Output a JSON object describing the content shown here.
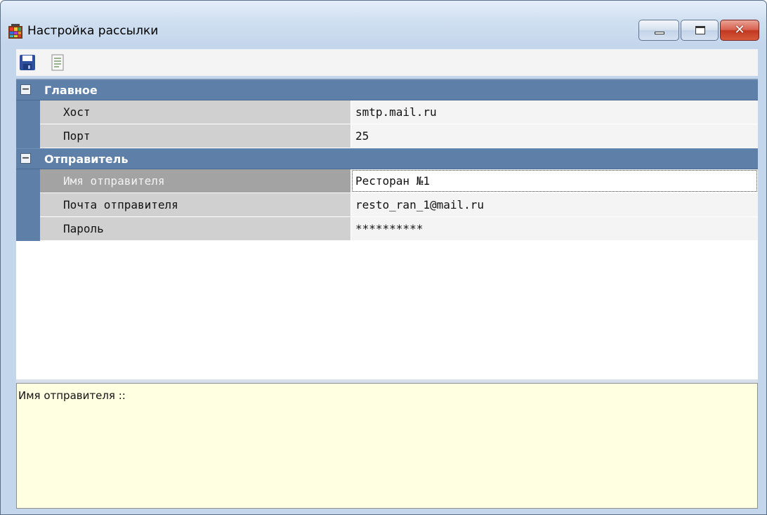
{
  "window": {
    "title": "Настройка рассылки",
    "colors": {
      "category_header": "#5d7fa8",
      "description_bg": "#ffffe1",
      "close_button": "#c1371f"
    }
  },
  "window_controls": {
    "minimize_icon": "minimize-icon",
    "maximize_icon": "maximize-icon",
    "close_label": "✕"
  },
  "toolbar": {
    "items": [
      {
        "name": "save",
        "icon": "floppy-disk-icon"
      },
      {
        "name": "description",
        "icon": "document-icon"
      }
    ]
  },
  "property_grid": {
    "categories": [
      {
        "label": "Главное",
        "toggle": "−",
        "properties": [
          {
            "name": "Хост",
            "value": "smtp.mail.ru"
          },
          {
            "name": "Порт",
            "value": "25"
          }
        ]
      },
      {
        "label": "Отправитель",
        "toggle": "−",
        "properties": [
          {
            "name": "Имя отправителя",
            "value": "Ресторан №1",
            "selected": true
          },
          {
            "name": "Почта отправителя",
            "value": "resto_ran_1@mail.ru"
          },
          {
            "name": "Пароль",
            "value": "**********"
          }
        ]
      }
    ]
  },
  "description": {
    "text": "Имя отправителя ::"
  }
}
